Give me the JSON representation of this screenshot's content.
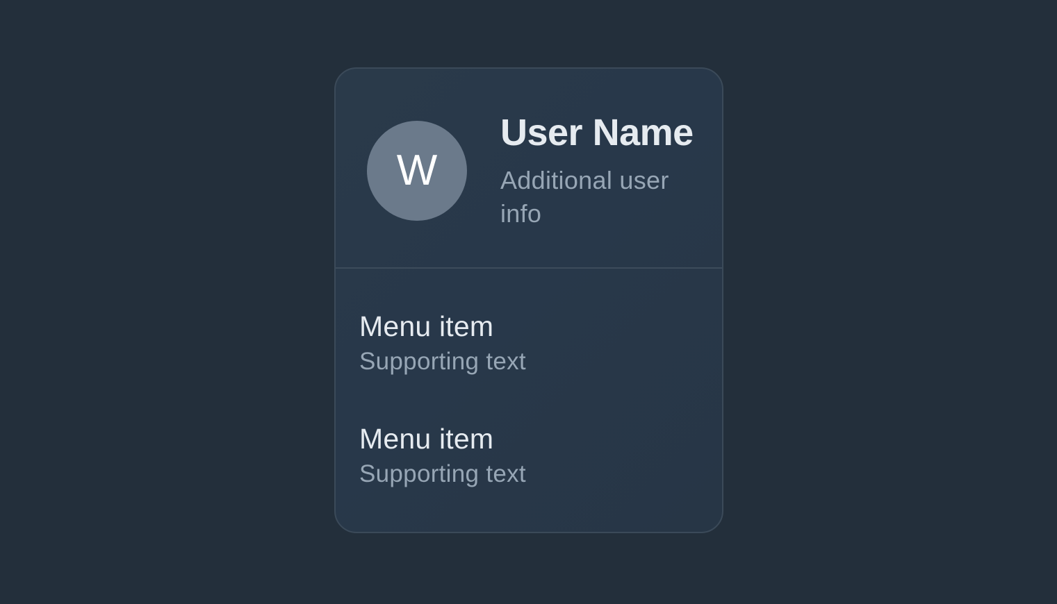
{
  "profile": {
    "avatar_initial": "W",
    "name": "User Name",
    "info": "Additional user info"
  },
  "menu": {
    "items": [
      {
        "label": "Menu item",
        "supporting": "Supporting text"
      },
      {
        "label": "Menu item",
        "supporting": "Supporting text"
      }
    ]
  },
  "colors": {
    "background": "#232f3b",
    "card": "#2a3a4a",
    "border": "#3b4a59",
    "avatar": "#6b7a8b",
    "primary_text": "#e6ebf0",
    "secondary_text": "#97a6b5"
  }
}
